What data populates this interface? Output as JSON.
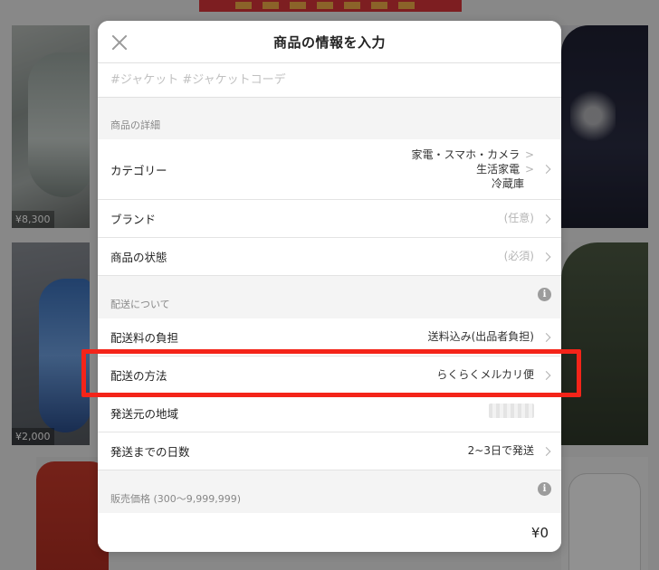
{
  "background_items": [
    {
      "price": "¥8,300"
    },
    {
      "price": "¥2,000"
    }
  ],
  "modal": {
    "title": "商品の情報を入力",
    "tags_placeholder": "#ジャケット #ジャケットコーデ",
    "details_section": {
      "heading": "商品の詳細",
      "category": {
        "label": "カテゴリー",
        "path": [
          "家電・スマホ・カメラ",
          "生活家電",
          "冷蔵庫"
        ],
        "separator": ">"
      },
      "brand": {
        "label": "ブランド",
        "value": "(任意)"
      },
      "condition": {
        "label": "商品の状態",
        "value": "(必須)"
      }
    },
    "shipping_section": {
      "heading": "配送について",
      "fee_payer": {
        "label": "配送料の負担",
        "value": "送料込み(出品者負担)"
      },
      "method": {
        "label": "配送の方法",
        "value": "らくらくメルカリ便"
      },
      "origin": {
        "label": "発送元の地域",
        "value": ""
      },
      "days": {
        "label": "発送までの日数",
        "value": "2~3日で発送"
      }
    },
    "price_section": {
      "heading": "販売価格 (300〜9,999,999)",
      "value": "¥0"
    }
  },
  "highlight_color": "#f42419",
  "icons": {
    "close": "close-icon",
    "info": "info-icon",
    "chevron": "chevron-right-icon"
  }
}
